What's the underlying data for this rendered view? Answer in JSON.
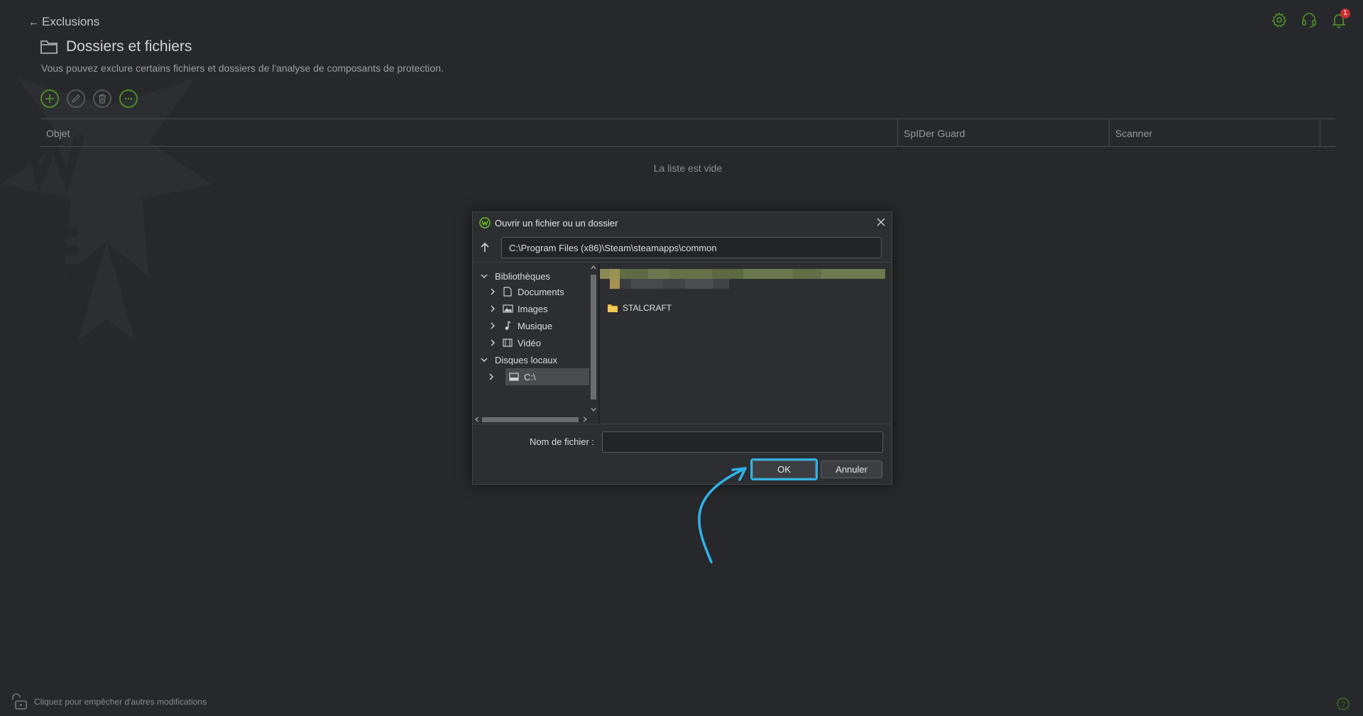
{
  "header": {
    "back_label": "Exclusions",
    "title": "Dossiers et fichiers",
    "subtitle": "Vous pouvez exclure certains fichiers et dossiers de l'analyse de composants de protection.",
    "notifications_count": "1",
    "top_icons": [
      "gear-icon",
      "headset-icon",
      "bell-icon"
    ]
  },
  "toolbar": {
    "buttons": [
      "add-icon",
      "edit-icon",
      "delete-icon",
      "more-icon"
    ]
  },
  "table": {
    "columns": [
      "Objet",
      "SpIDer Guard",
      "Scanner"
    ],
    "empty_message": "La liste est vide"
  },
  "footer": {
    "lock_text": "Cliquez pour empêcher d'autres modifications"
  },
  "dialog": {
    "title": "Ouvrir un fichier ou un dossier",
    "path": "C:\\Program Files (x86)\\Steam\\steamapps\\common",
    "tree": {
      "libraries": "Bibliothèques",
      "documents": "Documents",
      "images": "Images",
      "music": "Musique",
      "video": "Vidéo",
      "local_disks": "Disques locaux",
      "drive_c": "C:\\"
    },
    "files": [
      {
        "name": "STALCRAFT",
        "type": "folder"
      }
    ],
    "filename_label": "Nom de fichier :",
    "filename_value": "",
    "ok_label": "OK",
    "cancel_label": "Annuler"
  },
  "colors": {
    "background": "#27282b",
    "dialog": "#2d2e31",
    "accent_green": "#4c8a26",
    "highlight_blue": "#2fb3ea",
    "badge_red": "#c92e2e"
  }
}
